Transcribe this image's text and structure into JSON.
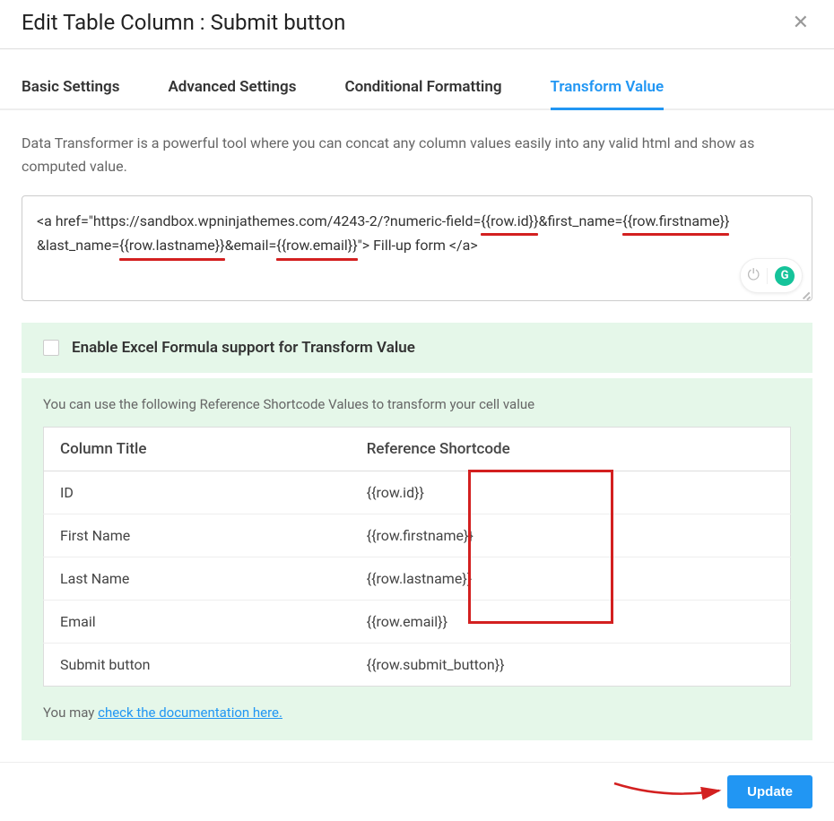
{
  "header": {
    "title": "Edit Table Column : Submit button"
  },
  "tabs": [
    {
      "label": "Basic Settings",
      "active": false
    },
    {
      "label": "Advanced Settings",
      "active": false
    },
    {
      "label": "Conditional Formatting",
      "active": false
    },
    {
      "label": "Transform Value",
      "active": true
    }
  ],
  "description": "Data Transformer is a powerful tool where you can concat any column values easily into any valid html and show as computed value.",
  "editor": {
    "parts": [
      {
        "text": "<a href=\"https://sandbox.wpninjathemes.com/4243-2/?numeric-field="
      },
      {
        "text": "{{row.id}}",
        "underline": true
      },
      {
        "text": "&first_name="
      },
      {
        "text": "{{row.firstname}}",
        "underline": true
      },
      {
        "text": "&last_name="
      },
      {
        "text": "{{row.lastname}}",
        "underline": true
      },
      {
        "text": "&email="
      },
      {
        "text": "{{row.email}}",
        "underline": true
      },
      {
        "text": "\"> Fill-up form </a>"
      }
    ],
    "grammarly_label": "G"
  },
  "excel": {
    "label": "Enable Excel Formula support for Transform Value",
    "checked": false
  },
  "shortcodes": {
    "intro": "You can use the following Reference Shortcode Values to transform your cell value",
    "headers": {
      "title": "Column Title",
      "code": "Reference Shortcode"
    },
    "rows": [
      {
        "title": "ID",
        "code": "{{row.id}}",
        "highlight": true
      },
      {
        "title": "First Name",
        "code": "{{row.firstname}}",
        "highlight": true
      },
      {
        "title": "Last Name",
        "code": "{{row.lastname}}",
        "highlight": true
      },
      {
        "title": "Email",
        "code": "{{row.email}}",
        "highlight": true
      },
      {
        "title": "Submit button",
        "code": "{{row.submit_button}}",
        "highlight": false
      }
    ],
    "doc_prefix": "You may ",
    "doc_link": "check the documentation here."
  },
  "footer": {
    "update_label": "Update"
  }
}
